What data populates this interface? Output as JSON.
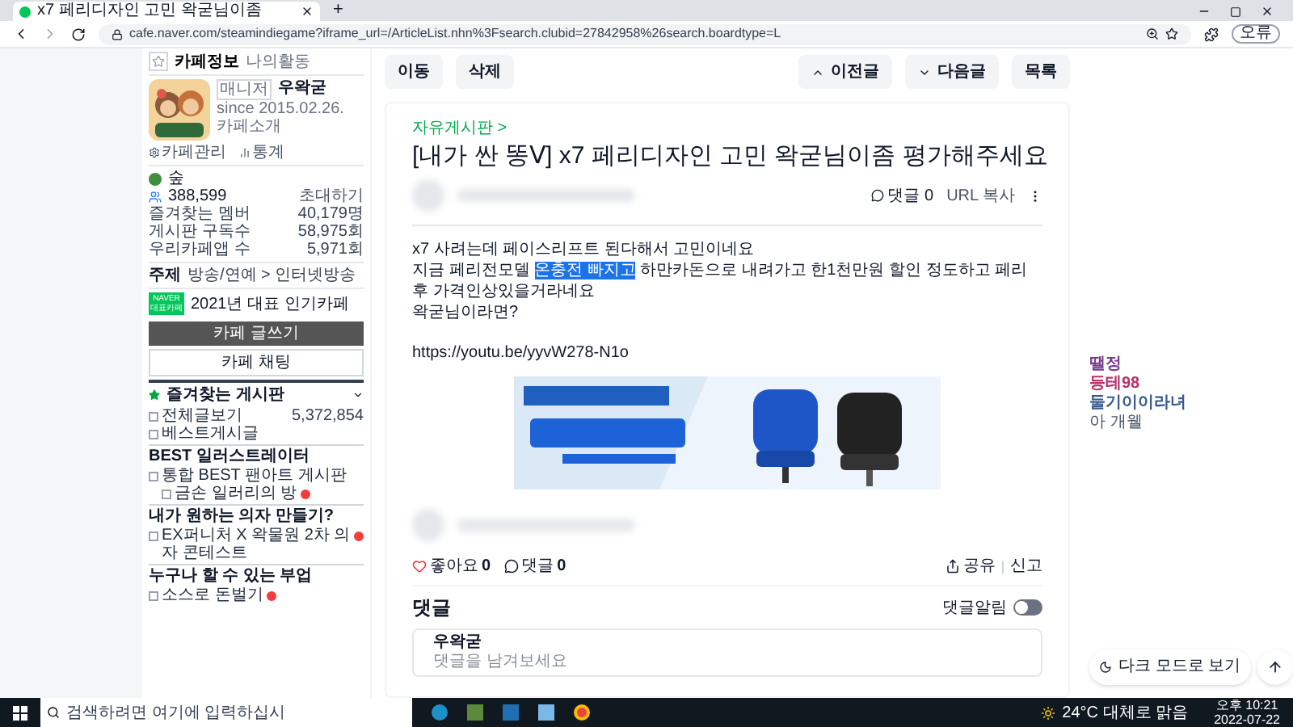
{
  "browser": {
    "tab_title": "x7 페리디자인 고민 왁굳님이좀",
    "new_tab": "+",
    "url": "cafe.naver.com/steamindiegame?iframe_url=/ArticleList.nhn%3Fsearch.clubid=27842958%26search.boardtype=L",
    "profile_button": "오류"
  },
  "sidebar": {
    "tabs": [
      {
        "label": "카페정보",
        "selected": true
      },
      {
        "label": "나의활동",
        "selected": false
      }
    ],
    "manager_badge": "매니저",
    "manager": "우왁굳",
    "since": "since 2015.02.26.",
    "intro_link": "카페소개",
    "admin_links": [
      "카페관리",
      "통계"
    ],
    "level": "숲",
    "members": "388,599",
    "invite": "초대하기",
    "stats": [
      {
        "label": "즐겨찾는 멤버",
        "value": "40,179명"
      },
      {
        "label": "게시판 구독수",
        "value": "58,975회"
      },
      {
        "label": "우리카페앱 수",
        "value": "5,971회"
      }
    ],
    "topic_label": "주제",
    "topic": "방송/연예 > 인터넷방송",
    "award_badge": [
      "NAVER",
      "대표카페"
    ],
    "award": "2021년 대표 인기카페",
    "write_button": "카페 글쓰기",
    "chat_button": "카페 채팅",
    "favorites": {
      "title": "즐겨찾는 게시판",
      "expanded": true
    },
    "boards": [
      {
        "kind": "board",
        "label": "전체글보기",
        "count": "5,372,854",
        "new": false
      },
      {
        "kind": "board",
        "label": "베스트게시글",
        "new": false
      },
      {
        "kind": "header",
        "label": "BEST 일러스트레이터"
      },
      {
        "kind": "board",
        "label": "통합 BEST 팬아트 게시판",
        "new": false
      },
      {
        "kind": "subboard",
        "label": "금손 일러리의 방",
        "new": true
      },
      {
        "kind": "header",
        "label": "내가 원하는 의자 만들기?"
      },
      {
        "kind": "board",
        "label": "EX퍼니처 X 왁물원 2차 의자 콘테스트",
        "new": true
      },
      {
        "kind": "header",
        "label": "누구나 할 수 있는 부업"
      },
      {
        "kind": "board",
        "label": "소스로 돈벌기",
        "new": true
      }
    ]
  },
  "toolbar": {
    "left": [
      "이동",
      "삭제"
    ],
    "right": [
      {
        "kind": "up",
        "label": "이전글"
      },
      {
        "kind": "down",
        "label": "다음글"
      },
      {
        "kind": "plain",
        "label": "목록"
      }
    ]
  },
  "article": {
    "board": "자유게시판 >",
    "title": "[내가 싼 똥ᐯ] x7 페리디자인 고민 왁굳님이좀 평가해주세요",
    "comment_count": "댓글 0",
    "url_copy": "URL 복사",
    "lines": [
      "x7 사려는데 페이스리프트 된다해서 고민이네요",
      "지금 페리전모델 **온충전 빠지고** 하만카돈으로 내려가고 한1천만원 할인 정도하고 페리후 가격인상있을거라네요",
      "왁굳님이라면?"
    ],
    "link": "https://youtu.be/yyvW278-N1o",
    "like": {
      "label": "좋아요",
      "count": "0",
      "liked": false
    },
    "comments": {
      "label": "댓글",
      "count": "0"
    },
    "share": "공유",
    "report": "신고"
  },
  "comment_section": {
    "title": "댓글",
    "alert_label": "댓글알림",
    "alert_on": false,
    "writer": "우왁굳",
    "placeholder": "댓글을 남겨보세요"
  },
  "chat_overlay": [
    {
      "name": "땔정",
      "color": "#7a3e8f"
    },
    {
      "name": "등테98",
      "color": "#b8336a"
    },
    {
      "name": "둘기이이라녀",
      "color": "#3a5a8f"
    }
  ],
  "chat_last": "아 개웰",
  "dark_mode_button": "다크 모드로 보기",
  "taskbar": {
    "search_placeholder": "검색하려면 여기에 입력하십시",
    "weather": "24°C 대체로 맑음",
    "time": "오후 10:21",
    "date": "2022-07-22"
  }
}
